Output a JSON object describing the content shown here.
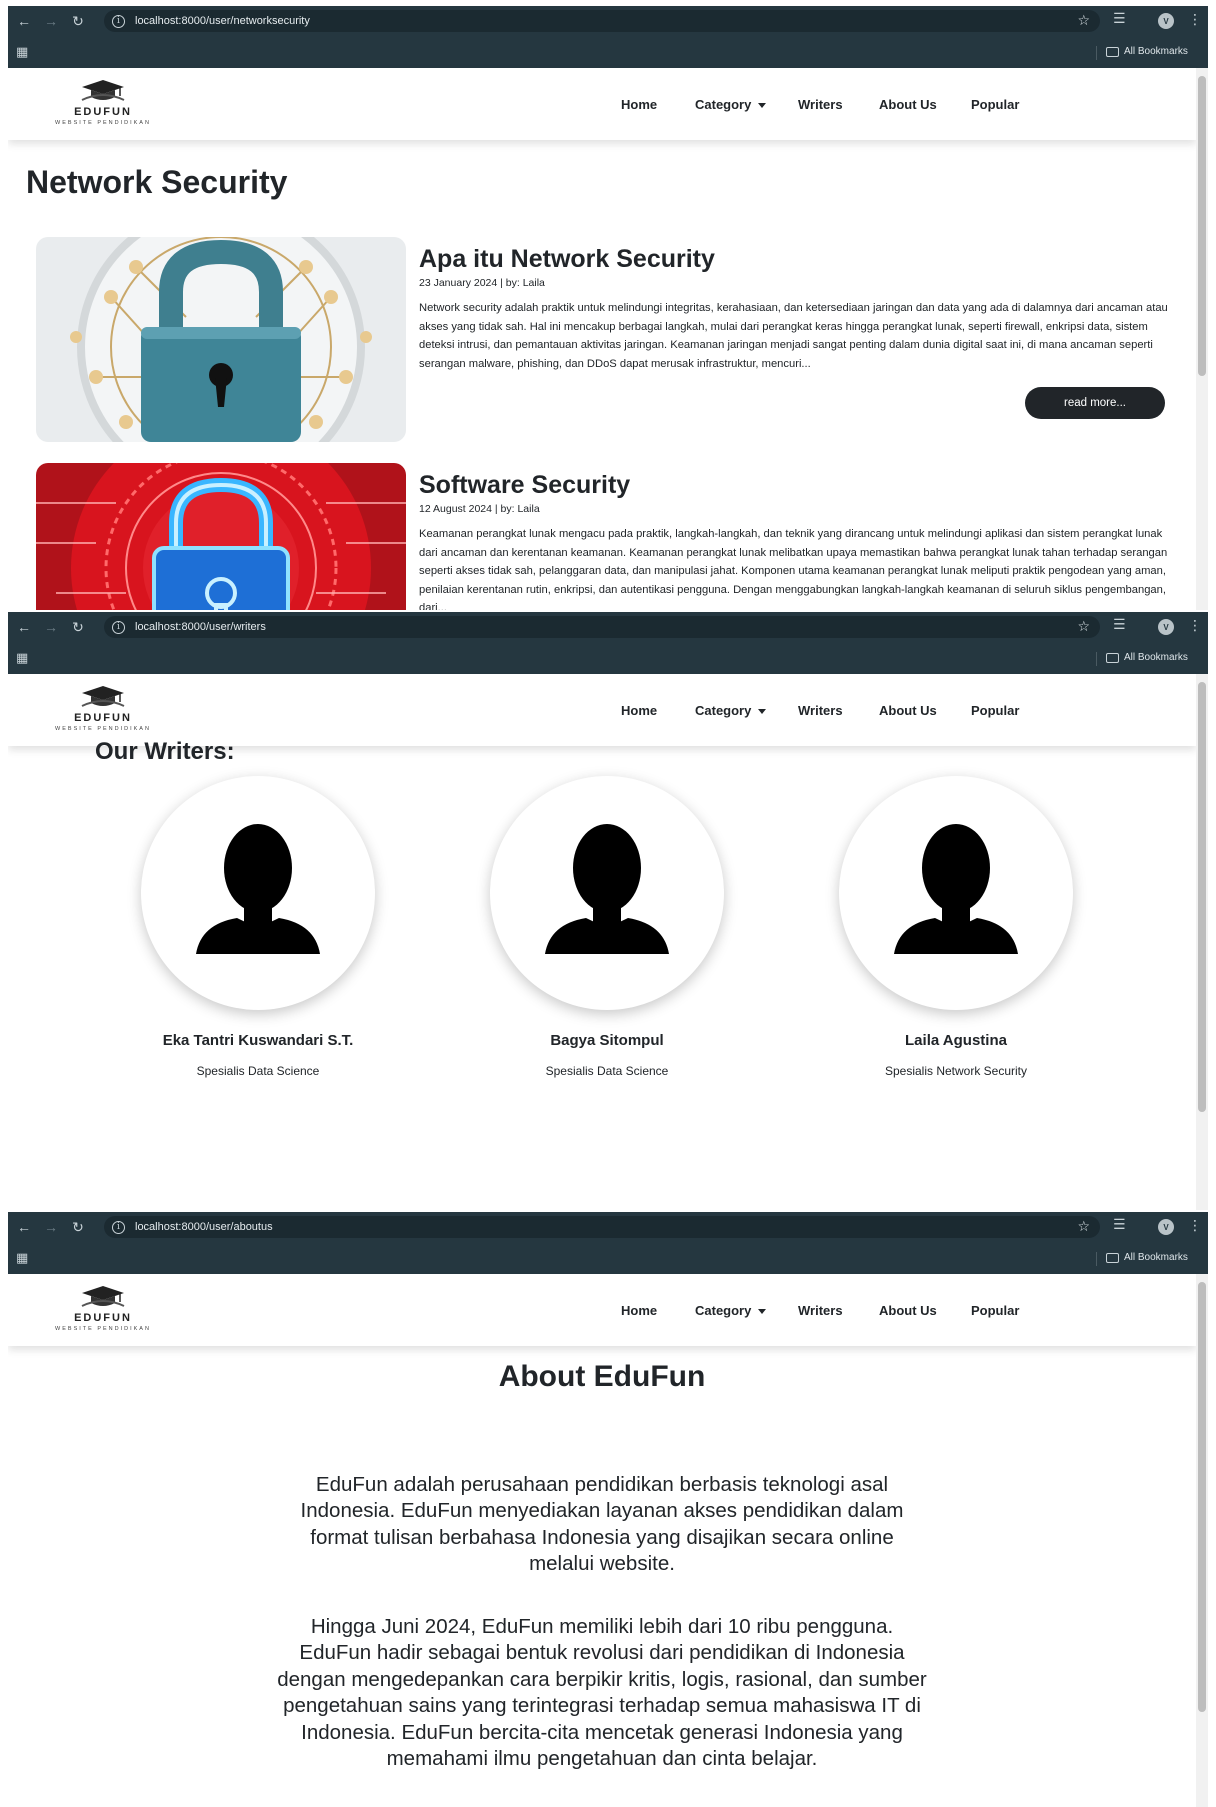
{
  "browser": {
    "bookmarks_label": "All Bookmarks",
    "profile_initial": "V"
  },
  "site": {
    "logo_name": "EDUFUN",
    "logo_sub": "WEBSITE PENDIDIKAN",
    "nav": {
      "home": "Home",
      "category": "Category",
      "writers": "Writers",
      "about": "About Us",
      "popular": "Popular"
    }
  },
  "screen1": {
    "url": "localhost:8000/user/networksecurity",
    "title": "Network Security",
    "posts": [
      {
        "title": "Apa itu Network Security",
        "meta": "23 January 2024 | by: Laila",
        "body": "Network security adalah praktik untuk melindungi integritas, kerahasiaan, dan ketersediaan jaringan dan data yang ada di dalamnya dari ancaman atau akses yang tidak sah. Hal ini mencakup berbagai langkah, mulai dari perangkat keras hingga perangkat lunak, seperti firewall, enkripsi data, sistem deteksi intrusi, dan pemantauan aktivitas jaringan. Keamanan jaringan menjadi sangat penting dalam dunia digital saat ini, di mana ancaman seperti serangan malware, phishing, dan DDoS dapat merusak infrastruktur, mencuri...",
        "read_more": "read more..."
      },
      {
        "title": "Software Security",
        "meta": "12 August 2024 | by: Laila",
        "body": "Keamanan perangkat lunak mengacu pada praktik, langkah-langkah, dan teknik yang dirancang untuk melindungi aplikasi dan sistem perangkat lunak dari ancaman dan kerentanan keamanan. Keamanan perangkat lunak melibatkan upaya memastikan bahwa perangkat lunak tahan terhadap serangan seperti akses tidak sah, pelanggaran data, dan manipulasi jahat. Komponen utama keamanan perangkat lunak meliputi praktik pengodean yang aman, penilaian kerentanan rutin, enkripsi, dan autentikasi pengguna. Dengan menggabungkan langkah-langkah keamanan di seluruh siklus pengembangan, dari..."
      }
    ]
  },
  "screen2": {
    "url": "localhost:8000/user/writers",
    "title": "Our Writers:",
    "writers": [
      {
        "name": "Eka Tantri Kuswandari S.T.",
        "specialty": "Spesialis Data Science"
      },
      {
        "name": "Bagya Sitompul",
        "specialty": "Spesialis Data Science"
      },
      {
        "name": "Laila Agustina",
        "specialty": "Spesialis Network Security"
      }
    ]
  },
  "screen3": {
    "url": "localhost:8000/user/aboutus",
    "title": "About EduFun",
    "paragraphs": [
      "EduFun adalah perusahaan pendidikan berbasis teknologi asal Indonesia. EduFun menyediakan layanan akses pendidikan dalam format tulisan berbahasa Indonesia yang disajikan secara online melalui website.",
      "Hingga Juni 2024, EduFun memiliki lebih dari 10 ribu pengguna. EduFun hadir sebagai bentuk revolusi dari pendidikan di Indonesia dengan mengedepankan cara berpikir kritis, logis, rasional, dan sumber pengetahuan sains yang terintegrasi terhadap semua mahasiswa IT di Indonesia. EduFun bercita-cita mencetak generasi Indonesia yang memahami ilmu pengetahuan dan cinta belajar."
    ]
  }
}
